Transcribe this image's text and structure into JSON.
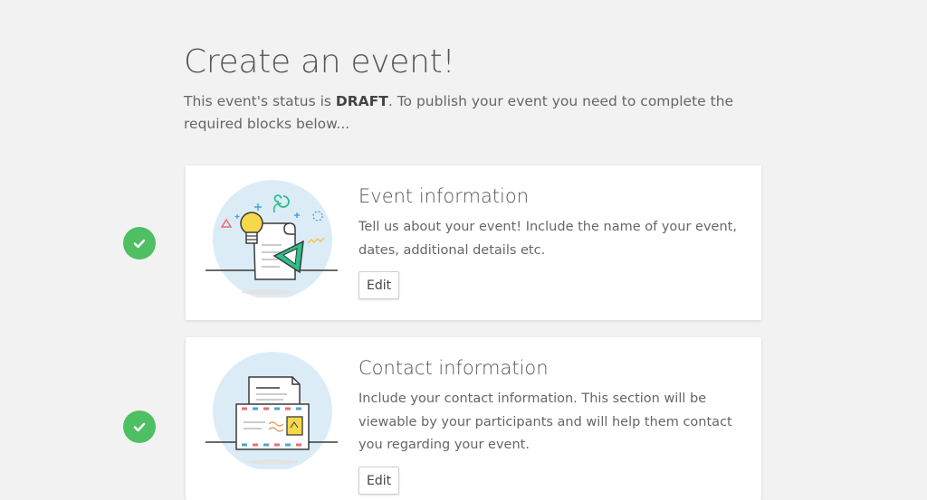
{
  "header": {
    "title": "Create an event!",
    "status_prefix": "This event's status is ",
    "status_value": "DRAFT",
    "status_suffix": ". To publish your event you need to complete the required blocks below..."
  },
  "blocks": [
    {
      "title": "Event information",
      "description": "Tell us about your event! Include the name of your event, dates, additional details etc.",
      "edit_label": "Edit",
      "completed": true,
      "icon": "lightbulb-document-icon"
    },
    {
      "title": "Contact information",
      "description": "Include your contact information. This section will be viewable by your participants and will help them contact you regarding your event.",
      "edit_label": "Edit",
      "completed": true,
      "icon": "envelope-letter-icon"
    }
  ],
  "colors": {
    "check_green": "#4fbf63",
    "background": "#f2f2f2",
    "card": "#ffffff",
    "illustration_circle": "#dcecf7",
    "accent_teal": "#2bbf8a",
    "accent_yellow": "#f5d94a"
  }
}
